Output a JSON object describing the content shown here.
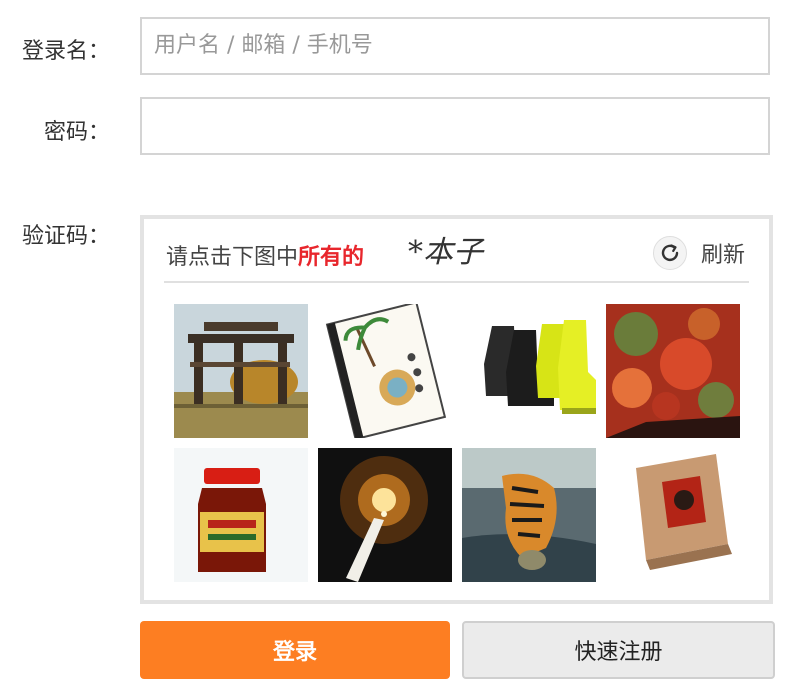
{
  "form": {
    "username_label": "登录名：",
    "username_placeholder": "用户名 / 邮箱 / 手机号",
    "password_label": "密码：",
    "captcha_label": "验证码："
  },
  "captcha": {
    "prompt_prefix": "请点击下图中",
    "prompt_keyword": "所有的",
    "target_glyph": "*本子",
    "refresh_label": "刷新",
    "images": [
      "pailou-gate",
      "notebook-palm-shell",
      "rain-boots",
      "red-foliage",
      "sauce-jar",
      "candle",
      "tiger",
      "pizza-box"
    ]
  },
  "buttons": {
    "login_label": "登录",
    "register_label": "快速注册"
  },
  "colors": {
    "accent": "#fd7e22",
    "keyword_red": "#e8262c"
  }
}
